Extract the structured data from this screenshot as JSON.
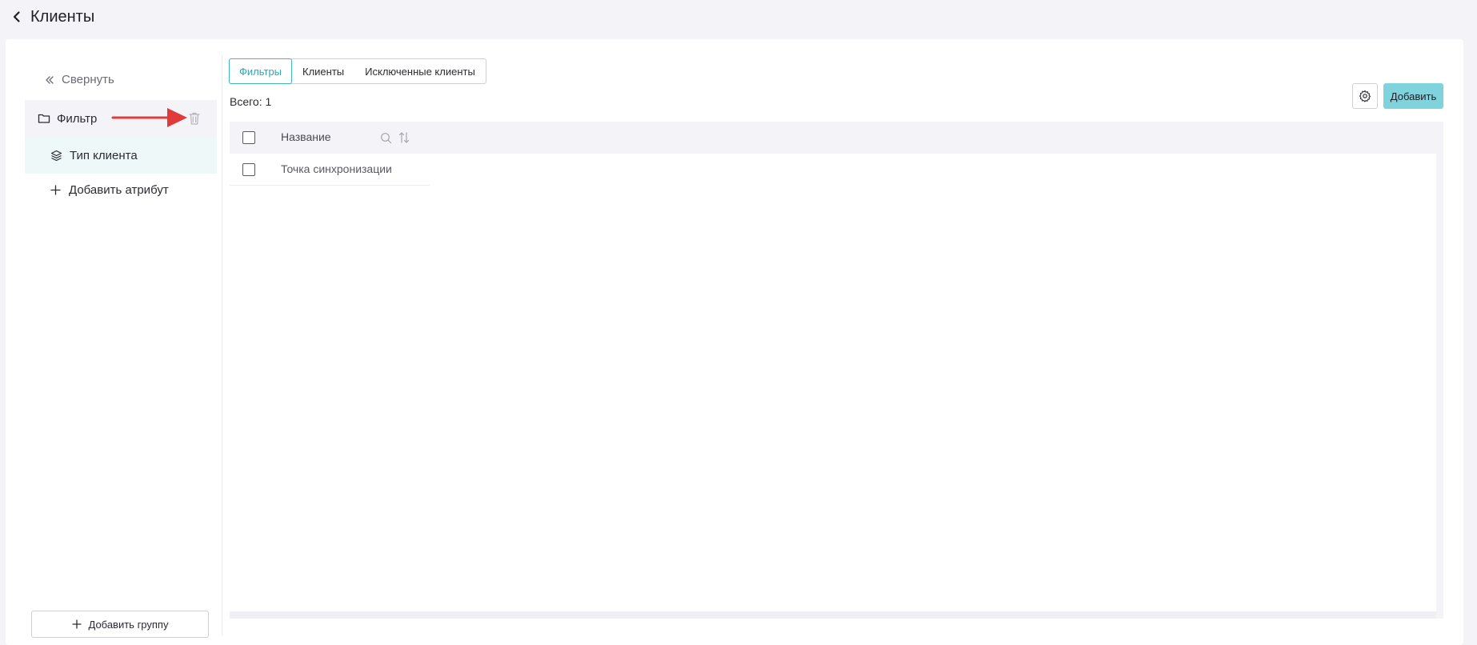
{
  "header": {
    "title": "Клиенты",
    "back_icon": "chevron-left-icon"
  },
  "sidebar": {
    "collapse_label": "Свернуть",
    "group": {
      "label": "Фильтр",
      "icon": "folder-icon",
      "delete_icon": "trash-icon"
    },
    "attributes": [
      {
        "label": "Тип клиента",
        "icon": "layers-icon"
      }
    ],
    "add_attribute_label": "Добавить атрибут",
    "add_group_label": "Добавить группу"
  },
  "main": {
    "tabs": [
      {
        "label": "Фильтры",
        "active": true
      },
      {
        "label": "Клиенты",
        "active": false
      },
      {
        "label": "Исключенные клиенты",
        "active": false
      }
    ],
    "total": "Всего: 1",
    "add_button_label": "Добавить",
    "table": {
      "columns": [
        {
          "label": "Название"
        }
      ],
      "rows": [
        {
          "name": "Точка синхронизации"
        }
      ]
    }
  },
  "colors": {
    "accent": "#43b5c0",
    "primary_button": "#7fd3dc",
    "selected_row": "#eef8f8",
    "annotation_arrow": "#e03a3a"
  }
}
